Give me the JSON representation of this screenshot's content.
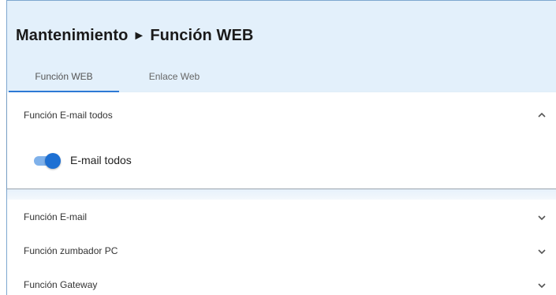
{
  "header": {
    "crumb_parent": "Mantenimiento",
    "crumb_separator": "►",
    "crumb_current": "Función WEB"
  },
  "tabs": [
    {
      "label": "Función WEB",
      "active": true
    },
    {
      "label": "Enlace Web",
      "active": false
    }
  ],
  "panels": {
    "open": {
      "title": "Función E-mail todos",
      "toggle": {
        "label": "E-mail todos",
        "on": true
      }
    },
    "collapsed": [
      {
        "title": "Función E-mail"
      },
      {
        "title": "Función zumbador PC"
      },
      {
        "title": "Función Gateway"
      }
    ]
  },
  "icons": {
    "expanded": "chevron-up-icon",
    "collapsed": "chevron-down-icon"
  },
  "colors": {
    "header_bg": "#e3f0fb",
    "accent": "#2d7ad6",
    "toggle_knob": "#1e70d3",
    "toggle_track": "#7fb1ea"
  }
}
